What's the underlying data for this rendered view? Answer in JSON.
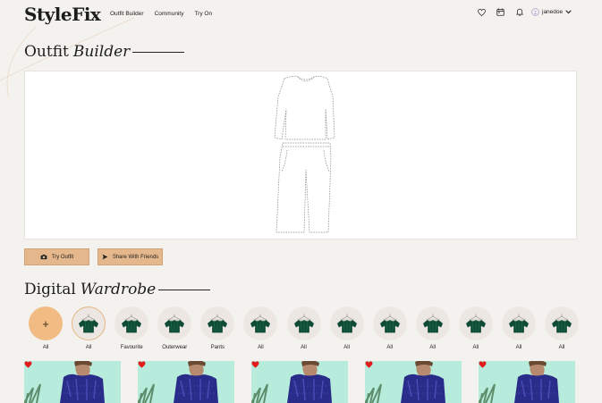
{
  "header": {
    "logo": "StyleFix",
    "nav": [
      "Outfit Builder",
      "Community",
      "Try On"
    ],
    "icons": [
      "heart-icon",
      "calendar-icon",
      "bell-icon"
    ],
    "username": "janedoe"
  },
  "outfit_builder": {
    "title_plain": "Outfit",
    "title_italic": "Builder",
    "try_button": "Try Outfit",
    "share_button": "Share With Friends"
  },
  "wardrobe": {
    "title_plain": "Digital",
    "title_italic": "Wardrobe",
    "add_label": "All",
    "add_symbol": "+",
    "categories": [
      "All",
      "Favourite",
      "Outerwear",
      "Pants",
      "All",
      "All",
      "All",
      "All",
      "All",
      "All",
      "All",
      "All"
    ],
    "item_count": 5,
    "accent": "#e4b88c",
    "heart_color": "#e21b1b"
  }
}
